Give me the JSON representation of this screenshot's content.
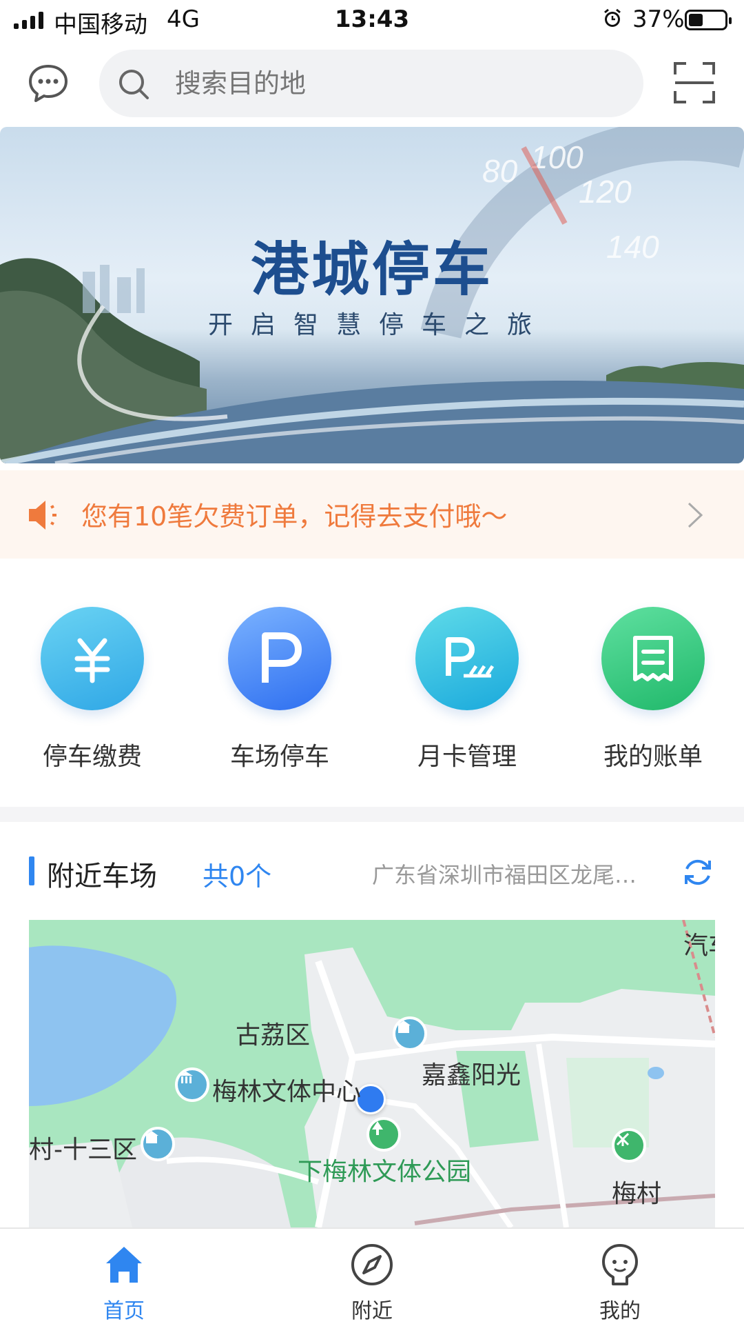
{
  "status_bar": {
    "carrier": "中国移动",
    "network": "4G",
    "time": "13:43",
    "battery_percent": "37%"
  },
  "header": {
    "message_icon": "chat-bubble-icon",
    "search_placeholder": "搜索目的地",
    "scan_icon": "scan-frame-icon"
  },
  "banner": {
    "title": "港城停车",
    "subtitle": "开启智慧停车之旅"
  },
  "notice": {
    "icon": "speaker-icon",
    "text": "您有10笔欠费订单，记得去支付哦～"
  },
  "actions": [
    {
      "label": "停车缴费",
      "icon": "yuan-icon"
    },
    {
      "label": "车场停车",
      "icon": "parking-icon"
    },
    {
      "label": "月卡管理",
      "icon": "parking-card-icon"
    },
    {
      "label": "我的账单",
      "icon": "bill-icon"
    }
  ],
  "nearby": {
    "title": "附近车场",
    "count": "共0个",
    "address": "广东省深圳市福田区龙尾…"
  },
  "map": {
    "labels": {
      "district": "古荔区",
      "place1": "嘉鑫阳光",
      "place2": "梅林文体中心",
      "place3": "村-十三区",
      "park": "下梅林文体公园",
      "metro": "梅村",
      "edge": "汽车"
    }
  },
  "tabbar": [
    {
      "label": "首页",
      "icon": "home-icon",
      "active": true
    },
    {
      "label": "附近",
      "icon": "compass-icon",
      "active": false
    },
    {
      "label": "我的",
      "icon": "profile-icon",
      "active": false
    }
  ],
  "colors": {
    "accent": "#2f86f0",
    "notice_text": "#ef7a3d",
    "notice_bg": "#fef6f0"
  }
}
